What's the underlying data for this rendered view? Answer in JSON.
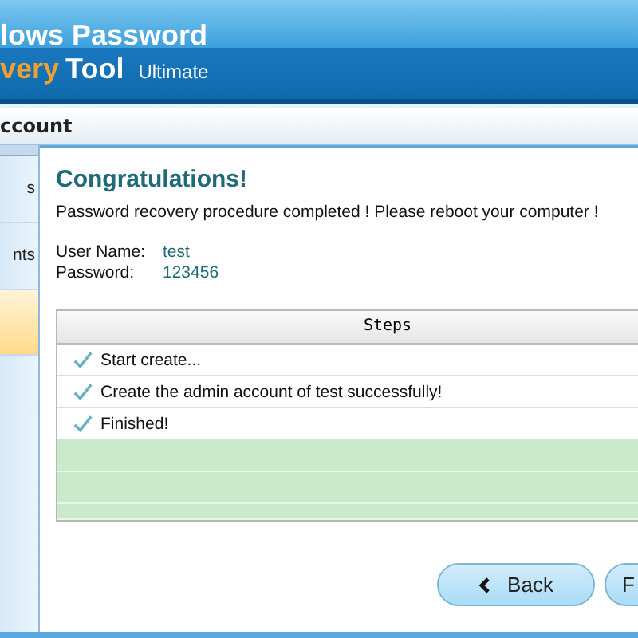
{
  "header": {
    "title_line_1": "lows Password",
    "title_accent": "very",
    "title_line_2": "Tool",
    "edition": "Ultimate"
  },
  "section_title": "ccount",
  "sidebar": {
    "items": [
      {
        "label": "s",
        "selected": false
      },
      {
        "label": "nts",
        "selected": false
      },
      {
        "selected": true
      }
    ]
  },
  "content": {
    "heading": "Congratulations!",
    "message": "Password recovery procedure completed ! Please reboot your computer !",
    "fields": [
      {
        "label": "User Name:",
        "value": "test"
      },
      {
        "label": "Password:",
        "value": "123456"
      }
    ],
    "steps": {
      "column": "Steps",
      "rows": [
        {
          "text": "Start create..."
        },
        {
          "text": "Create the admin account of test successfully!"
        },
        {
          "text": "Finished!"
        }
      ]
    }
  },
  "buttons": [
    {
      "kind": "back",
      "label": "Back"
    },
    {
      "kind": "next",
      "label": "F"
    }
  ]
}
